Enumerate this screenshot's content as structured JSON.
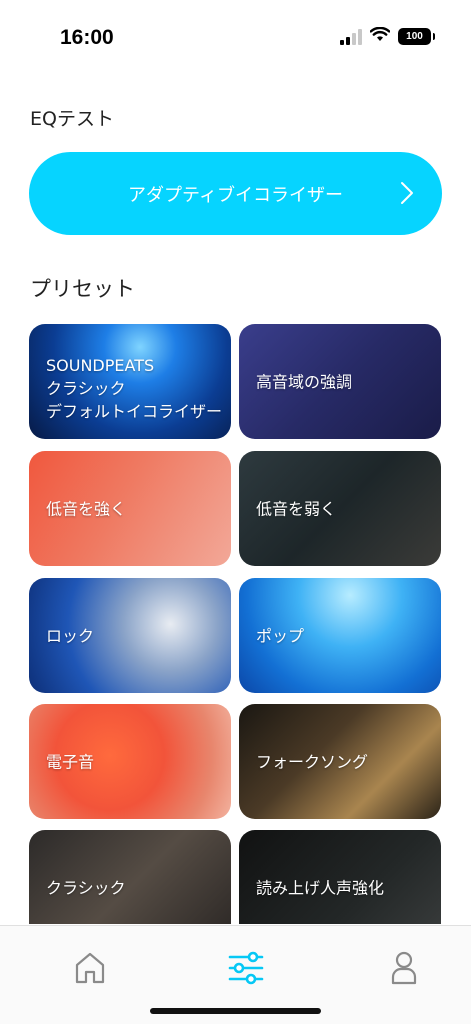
{
  "status_bar": {
    "time": "16:00",
    "battery": "100",
    "icons": [
      "cellular-signal-icon",
      "wifi-icon",
      "battery-icon"
    ]
  },
  "eq_test": {
    "title": "EQテスト",
    "adaptive_button_label": "アダプティブイコライザー",
    "chevron_icon": "chevron-right-icon"
  },
  "presets": {
    "title": "プリセット",
    "items": [
      {
        "lines": [
          "SOUNDPEATS",
          "クラシック",
          "デフォルトイコライザー"
        ]
      },
      {
        "lines": [
          "高音域の強調"
        ]
      },
      {
        "lines": [
          "低音を強く"
        ]
      },
      {
        "lines": [
          "低音を弱く"
        ]
      },
      {
        "lines": [
          "ロック"
        ]
      },
      {
        "lines": [
          "ポップ"
        ]
      },
      {
        "lines": [
          "電子音"
        ]
      },
      {
        "lines": [
          "フォークソング"
        ]
      },
      {
        "lines": [
          "クラシック"
        ]
      },
      {
        "lines": [
          "読み上げ人声強化"
        ]
      }
    ]
  },
  "tab_bar": {
    "tabs": [
      {
        "icon": "home-icon",
        "active": false
      },
      {
        "icon": "equalizer-sliders-icon",
        "active": true
      },
      {
        "icon": "profile-icon",
        "active": false
      }
    ]
  },
  "colors": {
    "accent": "#06d4ff",
    "tab_active": "#06c8f5",
    "tab_inactive": "#8a8a8a"
  }
}
